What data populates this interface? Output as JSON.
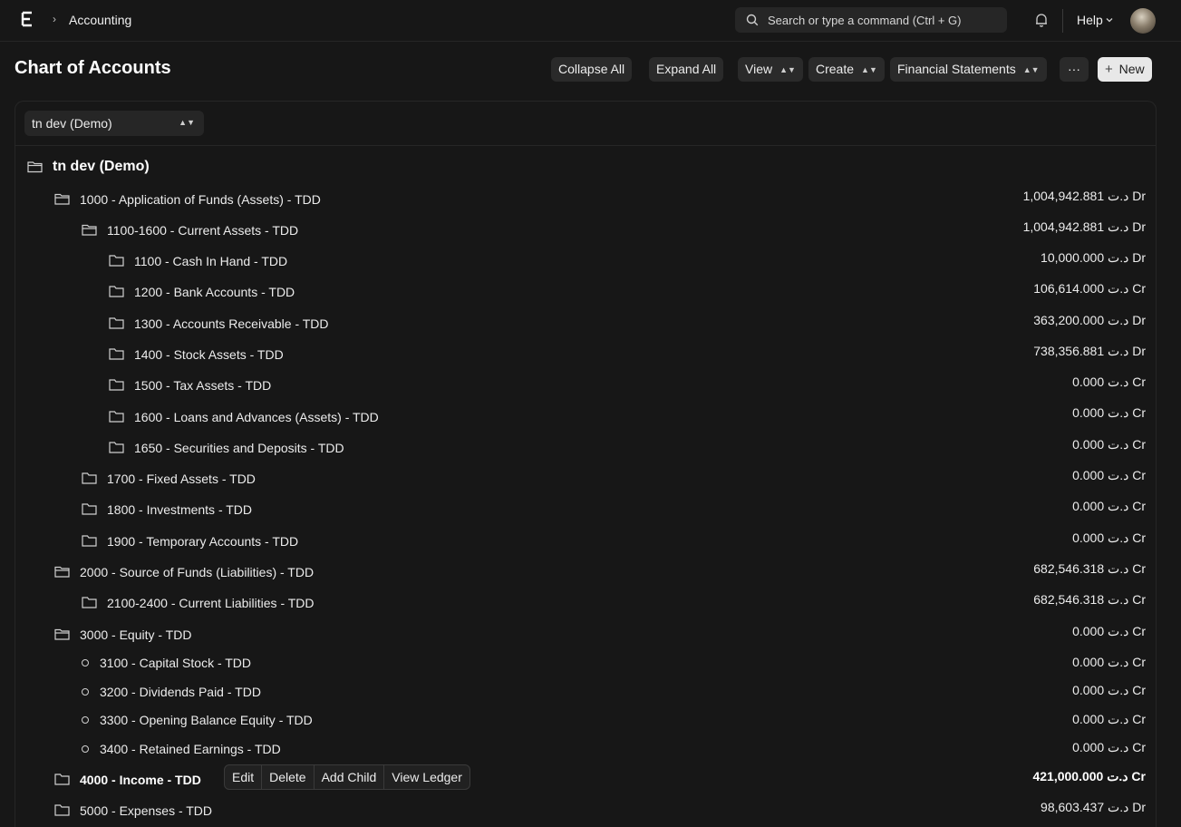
{
  "topbar": {
    "breadcrumb": "Accounting",
    "search_placeholder": "Search or type a command (Ctrl + G)",
    "help_label": "Help"
  },
  "page": {
    "title": "Chart of Accounts"
  },
  "toolbar": {
    "collapse_all": "Collapse All",
    "expand_all": "Expand All",
    "view": "View",
    "create": "Create",
    "financial_statements": "Financial Statements",
    "more": "···",
    "new": "New"
  },
  "company_filter": {
    "value": "tn dev (Demo)"
  },
  "tree": {
    "root": "tn dev (Demo)",
    "rows": [
      {
        "label": "1000 - Application of Funds (Assets) - TDD",
        "balance": "1,004,942.881 د.ت Dr"
      },
      {
        "label": "1100-1600 - Current Assets - TDD",
        "balance": "1,004,942.881 د.ت Dr"
      },
      {
        "label": "1100 - Cash In Hand - TDD",
        "balance": "10,000.000 د.ت Dr"
      },
      {
        "label": "1200 - Bank Accounts - TDD",
        "balance": "106,614.000 د.ت Cr"
      },
      {
        "label": "1300 - Accounts Receivable - TDD",
        "balance": "363,200.000 د.ت Dr"
      },
      {
        "label": "1400 - Stock Assets - TDD",
        "balance": "738,356.881 د.ت Dr"
      },
      {
        "label": "1500 - Tax Assets - TDD",
        "balance": "0.000 د.ت Cr"
      },
      {
        "label": "1600 - Loans and Advances (Assets) - TDD",
        "balance": "0.000 د.ت Cr"
      },
      {
        "label": "1650 - Securities and Deposits - TDD",
        "balance": "0.000 د.ت Cr"
      },
      {
        "label": "1700 - Fixed Assets - TDD",
        "balance": "0.000 د.ت Cr"
      },
      {
        "label": "1800 - Investments - TDD",
        "balance": "0.000 د.ت Cr"
      },
      {
        "label": "1900 - Temporary Accounts - TDD",
        "balance": "0.000 د.ت Cr"
      },
      {
        "label": "2000 - Source of Funds (Liabilities) - TDD",
        "balance": "682,546.318 د.ت Cr"
      },
      {
        "label": "2100-2400 - Current Liabilities - TDD",
        "balance": "682,546.318 د.ت Cr"
      },
      {
        "label": "3000 - Equity - TDD",
        "balance": "0.000 د.ت Cr"
      },
      {
        "label": "3100 - Capital Stock - TDD",
        "balance": "0.000 د.ت Cr"
      },
      {
        "label": "3200 - Dividends Paid - TDD",
        "balance": "0.000 د.ت Cr"
      },
      {
        "label": "3300 - Opening Balance Equity - TDD",
        "balance": "0.000 د.ت Cr"
      },
      {
        "label": "3400 - Retained Earnings - TDD",
        "balance": "0.000 د.ت Cr"
      },
      {
        "label": "4000 - Income - TDD",
        "balance": "421,000.000 د.ت Cr"
      },
      {
        "label": "5000 - Expenses - TDD",
        "balance": "98,603.437 د.ت Dr"
      }
    ]
  },
  "row_actions": {
    "edit": "Edit",
    "delete": "Delete",
    "add_child": "Add Child",
    "view_ledger": "View Ledger"
  }
}
